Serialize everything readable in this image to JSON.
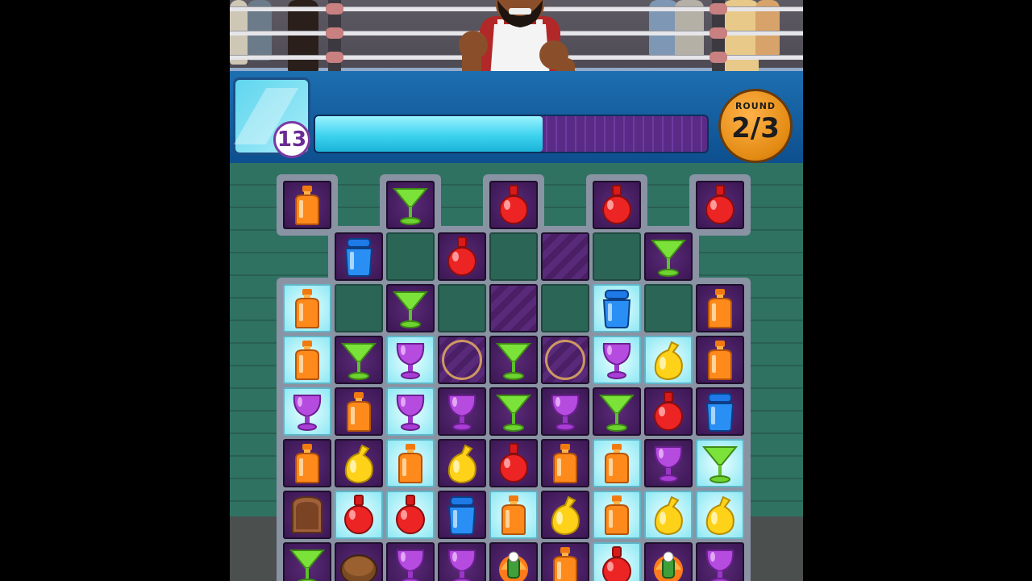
{
  "hud": {
    "moves_left": "13",
    "score_progress": 0.58,
    "round_label": "ROUND",
    "round_value": "2/3"
  },
  "colors": {
    "progress_fill": "#3dd2ef",
    "progress_empty": "#5a2b86",
    "cell_purple": "#4a1f66",
    "cell_light": "#bff4fb",
    "round_badge": "#e28a12"
  },
  "board": {
    "rows": [
      [
        "bottle-orange",
        "martini-green",
        "flask-red",
        "flask-red",
        "flask-red"
      ],
      [
        "jar-blue",
        "empty",
        "flask-red",
        "empty",
        "dark",
        "empty",
        "martini-green"
      ],
      [
        "bottle-orange",
        "empty",
        "martini-green",
        "empty",
        "dark",
        "empty",
        "jar-blue",
        "empty",
        "bottle-orange"
      ],
      [
        "bottle-orange",
        "martini-green",
        "goblet-purple",
        "ring",
        "martini-green",
        "ring",
        "goblet-purple",
        "bag-yellow",
        "bottle-orange"
      ],
      [
        "goblet-purple",
        "bottle-orange",
        "goblet-purple",
        "goblet-purple",
        "martini-green",
        "goblet-purple",
        "martini-green",
        "flask-red",
        "jar-blue"
      ],
      [
        "bottle-orange",
        "bag-yellow",
        "bottle-orange",
        "bag-yellow",
        "flask-red",
        "bottle-orange",
        "bottle-orange",
        "goblet-purple",
        "martini-green"
      ],
      [
        "toast",
        "flask-red",
        "flask-red",
        "jar-blue",
        "bottle-orange",
        "bag-yellow",
        "bottle-orange",
        "bag-yellow",
        "bag-yellow"
      ],
      [
        "martini-green",
        "pie",
        "goblet-purple",
        "goblet-purple",
        "special",
        "bottle-orange",
        "flask-red",
        "special",
        "goblet-purple"
      ]
    ]
  }
}
